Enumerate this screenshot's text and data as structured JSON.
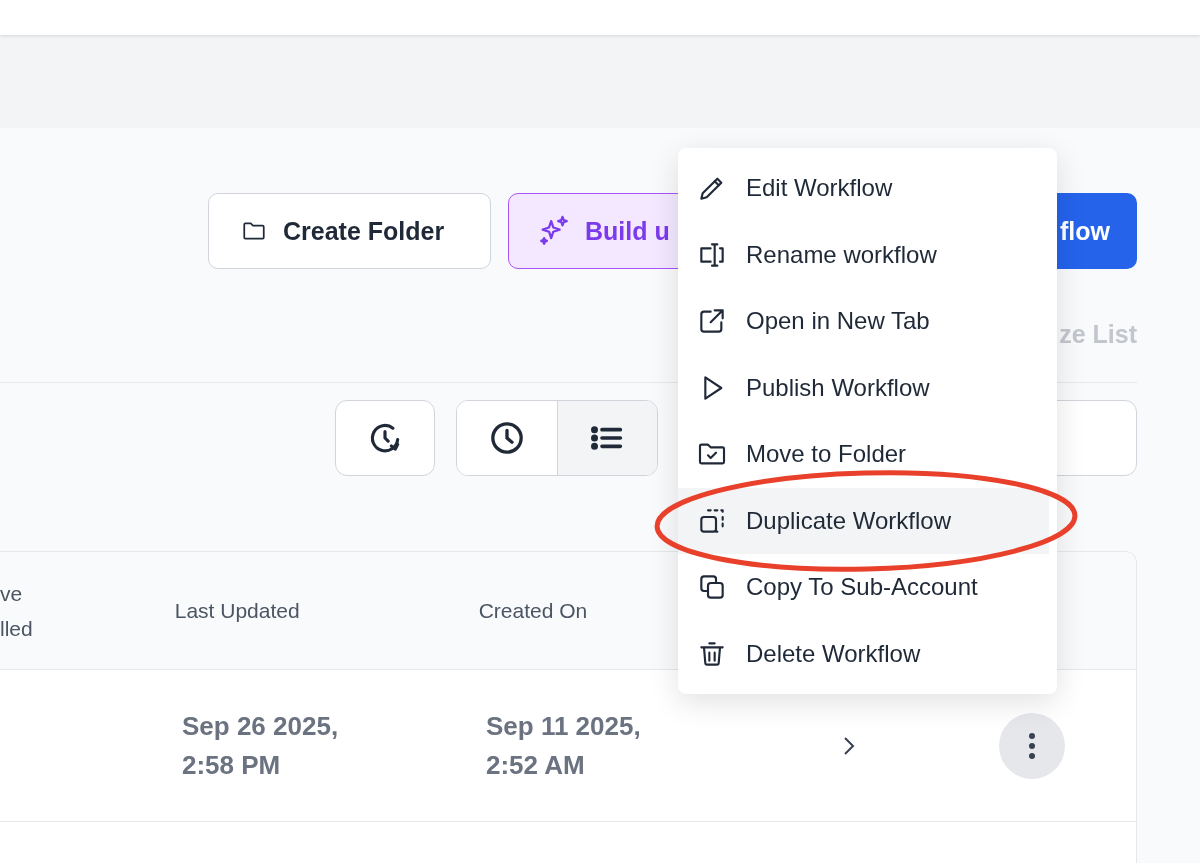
{
  "actions": [
    {
      "kind": "outline",
      "label": "Create Folder"
    },
    {
      "kind": "ai",
      "label": "Build u"
    },
    {
      "kind": "primary",
      "label": "flow"
    }
  ],
  "customize_link": "ze List",
  "view_toolbar": {
    "view_toggle": [
      {
        "kind": "clock",
        "selected": false
      },
      {
        "kind": "list",
        "selected": true
      }
    ]
  },
  "table": {
    "columns": [
      "ve\nlled",
      "Last Updated",
      "Created On"
    ],
    "rows": [
      {
        "last_updated": "Sep 26 2025,\n2:58 PM",
        "created_on": "Sep 11 2025,\n2:52 AM"
      }
    ]
  },
  "context_menu": [
    {
      "kind": "edit",
      "label": "Edit Workflow",
      "highlighted": false,
      "circled": false
    },
    {
      "kind": "rename",
      "label": "Rename workflow",
      "highlighted": false,
      "circled": false
    },
    {
      "kind": "open",
      "label": "Open in New Tab",
      "highlighted": false,
      "circled": false
    },
    {
      "kind": "publish",
      "label": "Publish Workflow",
      "highlighted": false,
      "circled": false
    },
    {
      "kind": "move",
      "label": "Move to Folder",
      "highlighted": false,
      "circled": false
    },
    {
      "kind": "duplicate",
      "label": "Duplicate Workflow",
      "highlighted": true,
      "circled": true
    },
    {
      "kind": "copy",
      "label": "Copy To Sub-Account",
      "highlighted": false,
      "circled": false
    },
    {
      "kind": "delete",
      "label": "Delete Workflow",
      "highlighted": false,
      "circled": false
    }
  ]
}
